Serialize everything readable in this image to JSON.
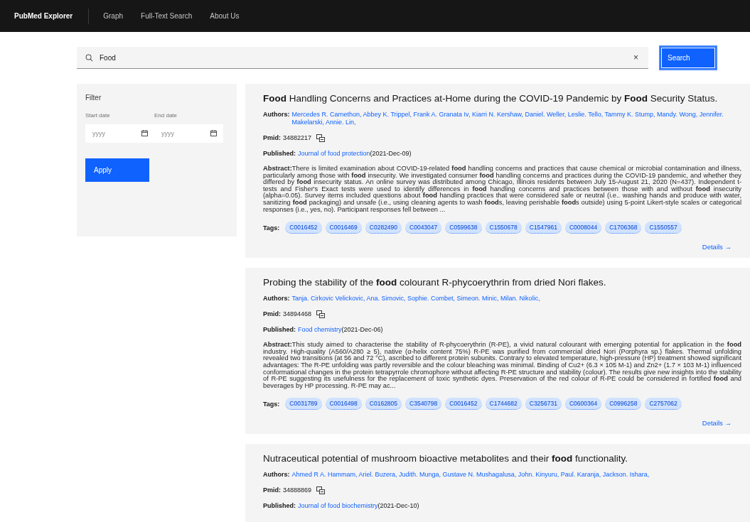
{
  "nav": {
    "brand": "PubMed Explorer",
    "items": [
      {
        "label": "Graph"
      },
      {
        "label": "Full-Text Search"
      },
      {
        "label": "About Us"
      }
    ]
  },
  "search": {
    "value": "Food",
    "clear": "×",
    "button": "Search"
  },
  "filter": {
    "title": "Filter",
    "start": {
      "label": "Start date",
      "placeholder": "yyyy"
    },
    "end": {
      "label": "End date",
      "placeholder": "yyyy"
    },
    "apply": "Apply"
  },
  "articles": [
    {
      "title": "**Food** Handling Concerns and Practices at-Home during the COVID-19 Pandemic by **Food** Security Status.",
      "authors_label": "Authors:",
      "authors": "Mercedes R. Carnethon, Abbey K. Trippel, Frank A. Granata Iv, Kiarri N. Kershaw, Daniel. Weller, Leslie. Tello, Tammy K. Stump, Mandy. Wong, Jennifer. Makelarski, Annie. Lin,",
      "pmid_label": "Pmid:",
      "pmid": "34882217",
      "published_label": "Published:",
      "journal": "Journal of food protection",
      "date": "(2021-Dec-09)",
      "abstract_label": "Abstract:",
      "abstract": "There is limited examination about COVID-19-related **food** handling concerns and practices that cause chemical or microbial contamination and illness, particularly among those with **food** insecurity. We investigated consumer **food** handling concerns and practices during the COVID-19 pandemic, and whether they differed by **food** insecurity status. An online survey was distributed among Chicago, Illinois residents between July 15-August 21, 2020 (N=437). Independent t-tests and Fisher's Exact tests were used to identify differences in **food** handling concerns and practices between those with and without **food** insecurity (alpha=0.05). Survey items included questions about **food** handling practices that were considered safe or neutral (i.e.. washing hands and produce with water, sanitizing **food** packaging) and unsafe (i.e., using cleaning agents to wash **food**s, leaving perishable **food**s outside) using 5-point Likert-style scales or categorical responses (i.e., yes, no). Participant responses fell between ...",
      "tags_label": "Tags:",
      "tags": [
        "C0016452",
        "C0016469",
        "C0282490",
        "C0043047",
        "C0599638",
        "C1550678",
        "C1547961",
        "C0008044",
        "C1706368",
        "C1550557"
      ],
      "details": "Details →"
    },
    {
      "title": "Probing the stability of the **food** colourant R-phycoerythrin from dried Nori flakes.",
      "authors_label": "Authors:",
      "authors": "Tanja. Cirkovic Velickovic, Ana. Simovic, Sophie. Combet, Simeon. Minic, Milan. Nikolic,",
      "pmid_label": "Pmid:",
      "pmid": "34894468",
      "published_label": "Published:",
      "journal": "Food chemistry",
      "date": "(2021-Dec-06)",
      "abstract_label": "Abstract:",
      "abstract": "This study aimed to characterise the stability of R-phycoerythrin (R-PE), a vivid natural colourant with emerging potential for application in the **food** industry. High-quality (A560/A280 ≥ 5), native (α-helix content 75%) R-PE was purified from commercial dried Nori (Porphyra sp.) flakes. Thermal unfolding revealed two transitions (at 56 and 72 °C), ascribed to different protein subunits. Contrary to elevated temperature, high-pressure (HP) treatment showed significant advantages: The R-PE unfolding was partly reversible and the colour bleaching was minimal. Binding of Cu2+ (6.3 × 105 M-1) and Zn2+ (1.7 × 103 M-1) influenced conformational changes in the protein tetrapyrrole chromophore without affecting R-PE structure and stability (colour). The results give new insights into the stability of R-PE suggesting its usefulness for the replacement of toxic synthetic dyes. Preservation of the red colour of R-PE could be considered in fortified **food** and beverages by HP processing. R-PE may ac...",
      "tags_label": "Tags:",
      "tags": [
        "C0031789",
        "C0016498",
        "C0162805",
        "C3540798",
        "C0016452",
        "C1744682",
        "C3256731",
        "C0600364",
        "C0996258",
        "C2757062"
      ],
      "details": "Details →"
    },
    {
      "title": "Nutraceutical potential of mushroom bioactive metabolites and their **food** functionality.",
      "authors_label": "Authors:",
      "authors": "Ahmed R A. Hammam, Ariel. Buzera, Judith. Munga, Gustave N. Mushagalusa, John. Kinyuru, Paul. Karanja, Jackson. Ishara,",
      "pmid_label": "Pmid:",
      "pmid": "34888869",
      "published_label": "Published:",
      "journal": "Journal of food biochemistry",
      "date": "(2021-Dec-10)"
    }
  ]
}
